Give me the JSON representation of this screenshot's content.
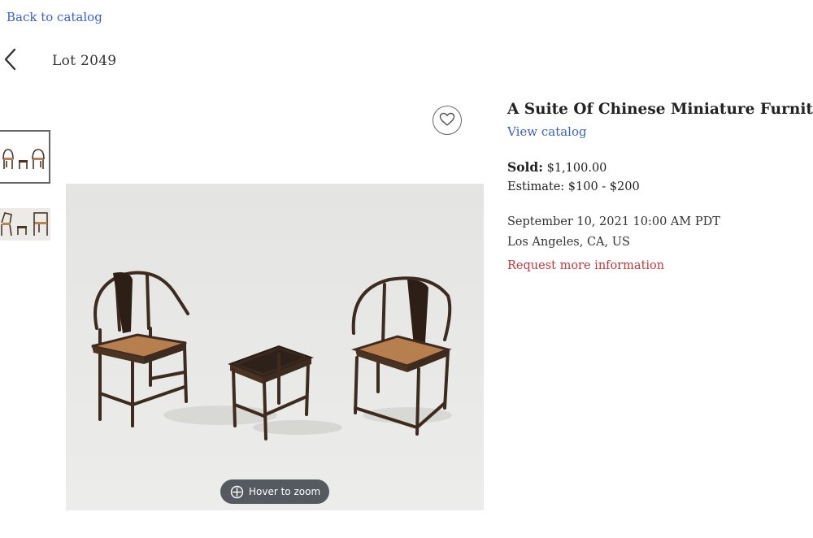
{
  "nav": {
    "back_to_catalog": "Back to catalog",
    "lot_title": "Lot  2049"
  },
  "gallery": {
    "thumbnails": [
      {
        "alt": "chairs-and-stool-view-1",
        "selected": true
      },
      {
        "alt": "chairs-and-stool-view-2",
        "selected": false
      }
    ],
    "zoom_hint": "Hover to zoom",
    "favorite_icon": "heart-icon"
  },
  "lot": {
    "title": "A Suite Of Chinese Miniature Furniture",
    "view_catalog": "View catalog",
    "sold_label": "Sold:",
    "sold_price": "$1,100.00",
    "estimate": "Estimate: $100 - $200",
    "date": "September 10, 2021 10:00 AM PDT",
    "location": "Los Angeles, CA, US",
    "request_info": "Request more information"
  },
  "colors": {
    "link": "#3b5fc9",
    "request": "#c8373c",
    "zoom_pill": "#555a60"
  }
}
